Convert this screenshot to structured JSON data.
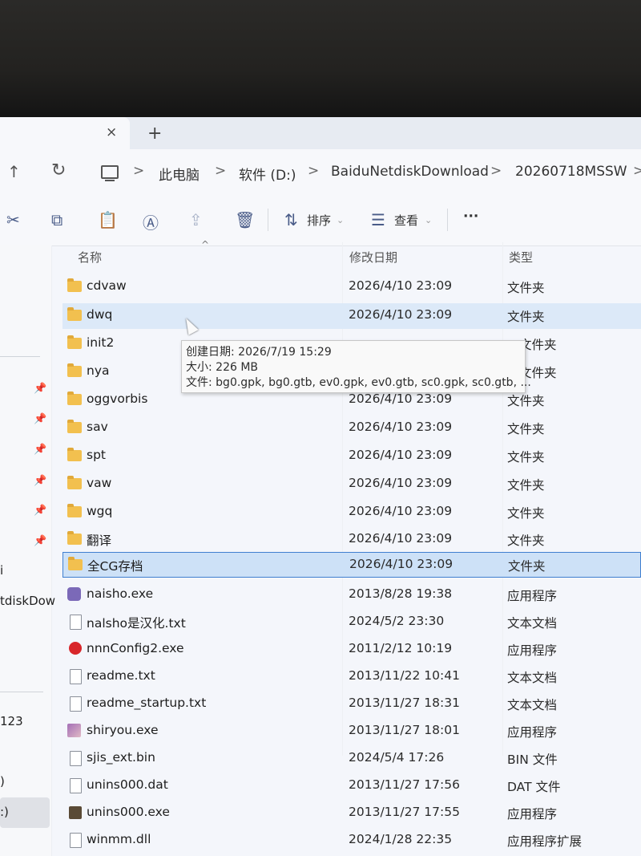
{
  "tabbar": {
    "close_glyph": "×",
    "add_glyph": "+"
  },
  "addressbar": {
    "breadcrumb": [
      "此电脑",
      "软件 (D:)",
      "BaiduNetdiskDownload",
      "20260718MSSW"
    ],
    "separator": ">"
  },
  "commandbar": {
    "sort_label": "排序",
    "view_label": "查看",
    "more_label": "···"
  },
  "columns": {
    "name": "名称",
    "date": "修改日期",
    "type": "类型"
  },
  "files": [
    {
      "name": "cdvaw",
      "date": "2026/4/10 23:09",
      "type": "文件夹",
      "icon": "folder"
    },
    {
      "name": "dwq",
      "date": "2026/4/10 23:09",
      "type": "文件夹",
      "icon": "folder"
    },
    {
      "name": "init2",
      "date": "",
      "type": "文件夹",
      "icon": "folder"
    },
    {
      "name": "nya",
      "date": "",
      "type": "文件夹",
      "icon": "folder"
    },
    {
      "name": "oggvorbis",
      "date": "2026/4/10 23:09",
      "type": "文件夹",
      "icon": "folder"
    },
    {
      "name": "sav",
      "date": "2026/4/10 23:09",
      "type": "文件夹",
      "icon": "folder"
    },
    {
      "name": "spt",
      "date": "2026/4/10 23:09",
      "type": "文件夹",
      "icon": "folder"
    },
    {
      "name": "vaw",
      "date": "2026/4/10 23:09",
      "type": "文件夹",
      "icon": "folder"
    },
    {
      "name": "wgq",
      "date": "2026/4/10 23:09",
      "type": "文件夹",
      "icon": "folder"
    },
    {
      "name": "翻译",
      "date": "2026/4/10 23:09",
      "type": "文件夹",
      "icon": "folder"
    },
    {
      "name": "全CG存档",
      "date": "2026/4/10 23:09",
      "type": "文件夹",
      "icon": "folder"
    },
    {
      "name": "naisho.exe",
      "date": "2013/8/28 19:38",
      "type": "应用程序",
      "icon": "app"
    },
    {
      "name": "nalsho是汉化.txt",
      "date": "2024/5/2 23:30",
      "type": "文本文档",
      "icon": "doc"
    },
    {
      "name": "nnnConfig2.exe",
      "date": "2011/2/12 10:19",
      "type": "应用程序",
      "icon": "gear"
    },
    {
      "name": "readme.txt",
      "date": "2013/11/22 10:41",
      "type": "文本文档",
      "icon": "doc"
    },
    {
      "name": "readme_startup.txt",
      "date": "2013/11/27 18:31",
      "type": "文本文档",
      "icon": "doc"
    },
    {
      "name": "shiryou.exe",
      "date": "2013/11/27 18:01",
      "type": "应用程序",
      "icon": "pic"
    },
    {
      "name": "sjis_ext.bin",
      "date": "2024/5/4 17:26",
      "type": "BIN 文件",
      "icon": "doc"
    },
    {
      "name": "unins000.dat",
      "date": "2013/11/27 17:56",
      "type": "DAT 文件",
      "icon": "doc"
    },
    {
      "name": "unins000.exe",
      "date": "2013/11/27 17:55",
      "type": "应用程序",
      "icon": "box"
    },
    {
      "name": "winmm.dll",
      "date": "2024/1/28 22:35",
      "type": "应用程序扩展",
      "icon": "doc"
    }
  ],
  "tooltip": {
    "created": "创建日期: 2026/7/19 15:29",
    "size": "大小: 226 MB",
    "files": "文件: bg0.gpk, bg0.gtb, ev0.gpk, ev0.gtb, sc0.gpk, sc0.gtb, ..."
  },
  "navpane": {
    "label_1": "i",
    "label_2": "tdiskDow",
    "label_3": "123",
    "label_4": ")",
    "label_5": ":)"
  }
}
